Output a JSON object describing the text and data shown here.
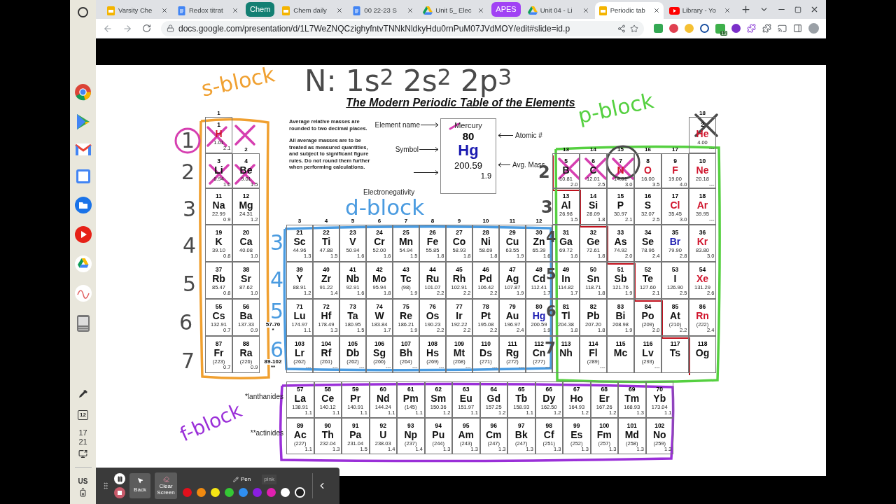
{
  "tabs": [
    {
      "kind": "tab",
      "title": "Varsity Che",
      "selected": false
    },
    {
      "kind": "tab",
      "title": "Redox titrat",
      "selected": false
    },
    {
      "kind": "group",
      "title": "Chem",
      "color": "#137f73"
    },
    {
      "kind": "tab",
      "title": "Chem daily",
      "selected": false
    },
    {
      "kind": "tab",
      "title": "00 22-23 S",
      "selected": false
    },
    {
      "kind": "tab",
      "title": "Unit 5_ Elec",
      "selected": false
    },
    {
      "kind": "group",
      "title": "APES",
      "color": "#a142f4"
    },
    {
      "kind": "tab",
      "title": "Unit 04 - Li",
      "selected": false
    },
    {
      "kind": "tab",
      "title": "Periodic tab",
      "selected": true
    },
    {
      "kind": "tab",
      "title": "Library - Yo",
      "selected": false
    }
  ],
  "address_bar": {
    "url": "docs.google.com/presentation/d/1L7WeZNQCzighyfntvTNNkNldkyHdu0rnPuM07JVdMOY/edit#slide=id.p",
    "extension_badge": "13"
  },
  "shelf": {
    "calendar_day": "12",
    "time_hour": "17",
    "time_minute": "21",
    "keyboard": "US"
  },
  "slide": {
    "title": "The Modern Periodic Table of the Elements",
    "notes": [
      "Average relative masses are  rounded to two decimal places.",
      "All average masses are to be treated as measured quantities, and subject to significant figure rules. Do not round them further when performing calculations."
    ],
    "key": {
      "name_label": "Element name",
      "name": "Mercury",
      "number": "80",
      "number_label": "Atomic #",
      "symbol_label": "Symbol",
      "symbol": "Hg",
      "mass": "200.59",
      "mass_label": "Avg. Mass",
      "en": "1.9",
      "en_label": "Electronegativity"
    },
    "group_labels": [
      "1",
      "18",
      "2",
      "13",
      "14",
      "15",
      "16",
      "17",
      "3",
      "4",
      "5",
      "6",
      "7",
      "8",
      "9",
      "10",
      "11",
      "12"
    ],
    "periods": [
      [
        {
          "kind": "element",
          "number": "1",
          "symbol": "H",
          "mass": "1.01",
          "en": "2.1",
          "color": "#d0142c"
        },
        {
          "kind": "element",
          "number": "2",
          "symbol": "He",
          "mass": "4.00",
          "en": "---",
          "color": "#d0142c"
        }
      ],
      [
        {
          "kind": "element",
          "number": "3",
          "symbol": "Li",
          "mass": "6.94",
          "en": "1.0"
        },
        {
          "kind": "element",
          "number": "4",
          "symbol": "Be",
          "mass": "9.01",
          "en": "1.5"
        },
        {
          "kind": "element",
          "number": "5",
          "symbol": "B",
          "mass": "10.81",
          "en": "2.0"
        },
        {
          "kind": "element",
          "number": "6",
          "symbol": "C",
          "mass": "12.01",
          "en": "2.5"
        },
        {
          "kind": "element",
          "number": "7",
          "symbol": "N",
          "mass": "14.01",
          "en": "3.0",
          "color": "#d0142c"
        },
        {
          "kind": "element",
          "number": "8",
          "symbol": "O",
          "mass": "16.00",
          "en": "3.5",
          "color": "#d0142c"
        },
        {
          "kind": "element",
          "number": "9",
          "symbol": "F",
          "mass": "19.00",
          "en": "4.0",
          "color": "#d0142c"
        },
        {
          "kind": "element",
          "number": "10",
          "symbol": "Ne",
          "mass": "20.18",
          "en": "---",
          "color": "#d0142c"
        }
      ],
      [
        {
          "kind": "element",
          "number": "11",
          "symbol": "Na",
          "mass": "22.99",
          "en": "0.9"
        },
        {
          "kind": "element",
          "number": "12",
          "symbol": "Mg",
          "mass": "24.31",
          "en": "1.2"
        },
        {
          "kind": "element",
          "number": "13",
          "symbol": "Al",
          "mass": "26.98",
          "en": "1.5"
        },
        {
          "kind": "element",
          "number": "14",
          "symbol": "Si",
          "mass": "28.09",
          "en": "1.8"
        },
        {
          "kind": "element",
          "number": "15",
          "symbol": "P",
          "mass": "30.97",
          "en": "2.1"
        },
        {
          "kind": "element",
          "number": "16",
          "symbol": "S",
          "mass": "32.07",
          "en": "2.5"
        },
        {
          "kind": "element",
          "number": "17",
          "symbol": "Cl",
          "mass": "35.45",
          "en": "3.0",
          "color": "#d0142c"
        },
        {
          "kind": "element",
          "number": "18",
          "symbol": "Ar",
          "mass": "39.95",
          "en": "---",
          "color": "#d0142c"
        }
      ],
      [
        {
          "kind": "element",
          "number": "19",
          "symbol": "K",
          "mass": "39.10",
          "en": "0.8"
        },
        {
          "kind": "element",
          "number": "20",
          "symbol": "Ca",
          "mass": "40.08",
          "en": "1.0"
        },
        {
          "kind": "element",
          "number": "21",
          "symbol": "Sc",
          "mass": "44.96",
          "en": "1.3"
        },
        {
          "kind": "element",
          "number": "22",
          "symbol": "Ti",
          "mass": "47.88",
          "en": "1.5"
        },
        {
          "kind": "element",
          "number": "23",
          "symbol": "V",
          "mass": "50.94",
          "en": "1.6"
        },
        {
          "kind": "element",
          "number": "24",
          "symbol": "Cr",
          "mass": "52.00",
          "en": "1.6"
        },
        {
          "kind": "element",
          "number": "25",
          "symbol": "Mn",
          "mass": "54.94",
          "en": "1.5"
        },
        {
          "kind": "element",
          "number": "26",
          "symbol": "Fe",
          "mass": "55.85",
          "en": "1.8"
        },
        {
          "kind": "element",
          "number": "27",
          "symbol": "Co",
          "mass": "58.93",
          "en": "1.8"
        },
        {
          "kind": "element",
          "number": "28",
          "symbol": "Ni",
          "mass": "58.69",
          "en": "1.8"
        },
        {
          "kind": "element",
          "number": "29",
          "symbol": "Cu",
          "mass": "63.55",
          "en": "1.9"
        },
        {
          "kind": "element",
          "number": "30",
          "symbol": "Zn",
          "mass": "65.39",
          "en": "1.6"
        },
        {
          "kind": "element",
          "number": "31",
          "symbol": "Ga",
          "mass": "69.72",
          "en": "1.6"
        },
        {
          "kind": "element",
          "number": "32",
          "symbol": "Ge",
          "mass": "72.61",
          "en": "1.8"
        },
        {
          "kind": "element",
          "number": "33",
          "symbol": "As",
          "mass": "74.92",
          "en": "2.0"
        },
        {
          "kind": "element",
          "number": "34",
          "symbol": "Se",
          "mass": "78.96",
          "en": "2.4"
        },
        {
          "kind": "element",
          "number": "35",
          "symbol": "Br",
          "mass": "79.90",
          "en": "2.8",
          "color": "#1b1bb0"
        },
        {
          "kind": "element",
          "number": "36",
          "symbol": "Kr",
          "mass": "83.80",
          "en": "3.0",
          "color": "#d0142c"
        }
      ],
      [
        {
          "kind": "element",
          "number": "37",
          "symbol": "Rb",
          "mass": "85.47",
          "en": "0.8"
        },
        {
          "kind": "element",
          "number": "38",
          "symbol": "Sr",
          "mass": "87.62",
          "en": "1.0"
        },
        {
          "kind": "element",
          "number": "39",
          "symbol": "Y",
          "mass": "88.91",
          "en": "1.2"
        },
        {
          "kind": "element",
          "number": "40",
          "symbol": "Zr",
          "mass": "91.22",
          "en": "1.4"
        },
        {
          "kind": "element",
          "number": "41",
          "symbol": "Nb",
          "mass": "92.91",
          "en": "1.6"
        },
        {
          "kind": "element",
          "number": "42",
          "symbol": "Mo",
          "mass": "95.94",
          "en": "1.8"
        },
        {
          "kind": "element",
          "number": "43",
          "symbol": "Tc",
          "mass": "(98)",
          "en": "1.9"
        },
        {
          "kind": "element",
          "number": "44",
          "symbol": "Ru",
          "mass": "101.07",
          "en": "2.2"
        },
        {
          "kind": "element",
          "number": "45",
          "symbol": "Rh",
          "mass": "102.91",
          "en": "2.2"
        },
        {
          "kind": "element",
          "number": "46",
          "symbol": "Pd",
          "mass": "106.42",
          "en": "2.2"
        },
        {
          "kind": "element",
          "number": "47",
          "symbol": "Ag",
          "mass": "107.87",
          "en": "1.9"
        },
        {
          "kind": "element",
          "number": "48",
          "symbol": "Cd",
          "mass": "112.41",
          "en": "1.7"
        },
        {
          "kind": "element",
          "number": "49",
          "symbol": "In",
          "mass": "114.82",
          "en": "1.7"
        },
        {
          "kind": "element",
          "number": "50",
          "symbol": "Sn",
          "mass": "118.71",
          "en": "1.8"
        },
        {
          "kind": "element",
          "number": "51",
          "symbol": "Sb",
          "mass": "121.76",
          "en": "1.9"
        },
        {
          "kind": "element",
          "number": "52",
          "symbol": "Te",
          "mass": "127.60",
          "en": "2.1"
        },
        {
          "kind": "element",
          "number": "53",
          "symbol": "I",
          "mass": "126.90",
          "en": "2.5"
        },
        {
          "kind": "element",
          "number": "54",
          "symbol": "Xe",
          "mass": "131.29",
          "en": "2.6",
          "color": "#d0142c"
        }
      ],
      [
        {
          "kind": "element",
          "number": "55",
          "symbol": "Cs",
          "mass": "132.91",
          "en": "0.7"
        },
        {
          "kind": "element",
          "number": "56",
          "symbol": "Ba",
          "mass": "137.33",
          "en": "0.9"
        },
        {
          "kind": "ref",
          "range": "57-70",
          "mark": "*"
        },
        {
          "kind": "element",
          "number": "71",
          "symbol": "Lu",
          "mass": "174.97",
          "en": "1.1"
        },
        {
          "kind": "element",
          "number": "72",
          "symbol": "Hf",
          "mass": "178.49",
          "en": "1.3"
        },
        {
          "kind": "element",
          "number": "73",
          "symbol": "Ta",
          "mass": "180.95",
          "en": "1.5"
        },
        {
          "kind": "element",
          "number": "74",
          "symbol": "W",
          "mass": "183.84",
          "en": "1.7"
        },
        {
          "kind": "element",
          "number": "75",
          "symbol": "Re",
          "mass": "186.21",
          "en": "1.9"
        },
        {
          "kind": "element",
          "number": "76",
          "symbol": "Os",
          "mass": "190.23",
          "en": "2.2"
        },
        {
          "kind": "element",
          "number": "77",
          "symbol": "Ir",
          "mass": "192.22",
          "en": "2.2"
        },
        {
          "kind": "element",
          "number": "78",
          "symbol": "Pt",
          "mass": "195.08",
          "en": "2.2"
        },
        {
          "kind": "element",
          "number": "79",
          "symbol": "Au",
          "mass": "196.97",
          "en": "2.4"
        },
        {
          "kind": "element",
          "number": "80",
          "symbol": "Hg",
          "mass": "200.59",
          "en": "1.9",
          "color": "#1b1bb0"
        },
        {
          "kind": "element",
          "number": "81",
          "symbol": "Tl",
          "mass": "204.38",
          "en": "1.8"
        },
        {
          "kind": "element",
          "number": "82",
          "symbol": "Pb",
          "mass": "207.20",
          "en": "1.8"
        },
        {
          "kind": "element",
          "number": "83",
          "symbol": "Bi",
          "mass": "208.98",
          "en": "1.9"
        },
        {
          "kind": "element",
          "number": "84",
          "symbol": "Po",
          "mass": "(209)",
          "en": "2.0"
        },
        {
          "kind": "element",
          "number": "85",
          "symbol": "At",
          "mass": "(210)",
          "en": "2.2"
        },
        {
          "kind": "element",
          "number": "86",
          "symbol": "Rn",
          "mass": "(222)",
          "en": "2.4",
          "color": "#d0142c"
        }
      ],
      [
        {
          "kind": "element",
          "number": "87",
          "symbol": "Fr",
          "mass": "(223)",
          "en": "0.7"
        },
        {
          "kind": "element",
          "number": "88",
          "symbol": "Ra",
          "mass": "(226)",
          "en": "0.9"
        },
        {
          "kind": "ref",
          "range": "89-102",
          "mark": "**"
        },
        {
          "kind": "element",
          "number": "103",
          "symbol": "Lr",
          "mass": "(262)",
          "en": "---"
        },
        {
          "kind": "element",
          "number": "104",
          "symbol": "Rf",
          "mass": "(261)",
          "en": "---"
        },
        {
          "kind": "element",
          "number": "105",
          "symbol": "Db",
          "mass": "(262)",
          "en": "---"
        },
        {
          "kind": "element",
          "number": "106",
          "symbol": "Sg",
          "mass": "(266)",
          "en": "---"
        },
        {
          "kind": "element",
          "number": "107",
          "symbol": "Bh",
          "mass": "(264)",
          "en": "---"
        },
        {
          "kind": "element",
          "number": "108",
          "symbol": "Hs",
          "mass": "(269)",
          "en": "---"
        },
        {
          "kind": "element",
          "number": "109",
          "symbol": "Mt",
          "mass": "(268)",
          "en": "---"
        },
        {
          "kind": "element",
          "number": "110",
          "symbol": "Ds",
          "mass": "(271)",
          "en": "---"
        },
        {
          "kind": "element",
          "number": "111",
          "symbol": "Rg",
          "mass": "(272)",
          "en": "---"
        },
        {
          "kind": "element",
          "number": "112",
          "symbol": "Cn",
          "mass": "(277)",
          "en": "---"
        },
        {
          "kind": "element",
          "number": "113",
          "symbol": "Nh"
        },
        {
          "kind": "element",
          "number": "114",
          "symbol": "Fl",
          "mass": "(289)",
          "en": "---"
        },
        {
          "kind": "element",
          "number": "115",
          "symbol": "Mc"
        },
        {
          "kind": "element",
          "number": "116",
          "symbol": "Lv",
          "mass": "(293)",
          "en": "---"
        },
        {
          "kind": "element",
          "number": "117",
          "symbol": "Ts"
        },
        {
          "kind": "element",
          "number": "118",
          "symbol": "Og"
        }
      ]
    ],
    "f_rows": [
      {
        "label": "*lanthanides",
        "elements": [
          {
            "number": "57",
            "symbol": "La",
            "mass": "138.91",
            "en": "1.1"
          },
          {
            "number": "58",
            "symbol": "Ce",
            "mass": "140.12",
            "en": "1.1"
          },
          {
            "number": "59",
            "symbol": "Pr",
            "mass": "140.91",
            "en": "1.1"
          },
          {
            "number": "60",
            "symbol": "Nd",
            "mass": "144.24",
            "en": "1.1"
          },
          {
            "number": "61",
            "symbol": "Pm",
            "mass": "(145)",
            "en": "1.1"
          },
          {
            "number": "62",
            "symbol": "Sm",
            "mass": "150.36",
            "en": "1.2"
          },
          {
            "number": "63",
            "symbol": "Eu",
            "mass": "151.97",
            "en": "1.1"
          },
          {
            "number": "64",
            "symbol": "Gd",
            "mass": "157.25",
            "en": "1.2"
          },
          {
            "number": "65",
            "symbol": "Tb",
            "mass": "158.93",
            "en": "1.1"
          },
          {
            "number": "66",
            "symbol": "Dy",
            "mass": "162.50",
            "en": "1.2"
          },
          {
            "number": "67",
            "symbol": "Ho",
            "mass": "164.93",
            "en": "1.2"
          },
          {
            "number": "68",
            "symbol": "Er",
            "mass": "167.26",
            "en": "1.2"
          },
          {
            "number": "69",
            "symbol": "Tm",
            "mass": "168.93",
            "en": "1.3"
          },
          {
            "number": "70",
            "symbol": "Yb",
            "mass": "173.04",
            "en": "1.1"
          }
        ]
      },
      {
        "label": "**actinides",
        "elements": [
          {
            "number": "89",
            "symbol": "Ac",
            "mass": "(227)",
            "en": "1.1"
          },
          {
            "number": "90",
            "symbol": "Th",
            "mass": "232.04",
            "en": "1.3"
          },
          {
            "number": "91",
            "symbol": "Pa",
            "mass": "231.04",
            "en": "1.5"
          },
          {
            "number": "92",
            "symbol": "U",
            "mass": "238.03",
            "en": "1.4"
          },
          {
            "number": "93",
            "symbol": "Np",
            "mass": "(237)",
            "en": "1.4"
          },
          {
            "number": "94",
            "symbol": "Pu",
            "mass": "(244)",
            "en": "1.3"
          },
          {
            "number": "95",
            "symbol": "Am",
            "mass": "(243)",
            "en": "1.3"
          },
          {
            "number": "96",
            "symbol": "Cm",
            "mass": "(247)",
            "en": "1.3"
          },
          {
            "number": "97",
            "symbol": "Bk",
            "mass": "(247)",
            "en": "1.3"
          },
          {
            "number": "98",
            "symbol": "Cf",
            "mass": "(251)",
            "en": "1.3"
          },
          {
            "number": "99",
            "symbol": "Es",
            "mass": "(252)",
            "en": "1.3"
          },
          {
            "number": "100",
            "symbol": "Fm",
            "mass": "(257)",
            "en": "1.3"
          },
          {
            "number": "101",
            "symbol": "Md",
            "mass": "(258)",
            "en": "1.3"
          },
          {
            "number": "102",
            "symbol": "No",
            "mass": "(259)",
            "en": "1.3"
          }
        ]
      }
    ],
    "annotations": [
      {
        "text": "s-block",
        "color": "#f0a030"
      },
      {
        "text": "N: 1s$^{2}$ 2s$^{2}$ 2p$^{3}$",
        "color": "#4a4a4a"
      },
      {
        "text": "p-block",
        "color": "#55d040"
      },
      {
        "text": "d-block",
        "color": "#4a9be0"
      },
      {
        "text": "f-block",
        "color": "#9a2fd8"
      },
      {
        "text": "1",
        "color": "#4a4a4a"
      },
      {
        "text": "2",
        "color": "#4a4a4a"
      },
      {
        "text": "3",
        "color": "#4a4a4a"
      },
      {
        "text": "4",
        "color": "#4a4a4a"
      },
      {
        "text": "5",
        "color": "#4a4a4a"
      },
      {
        "text": "6",
        "color": "#4a4a4a"
      },
      {
        "text": "7",
        "color": "#4a4a4a"
      },
      {
        "text": "3",
        "color": "#4a9be0"
      },
      {
        "text": "4",
        "color": "#4a9be0"
      },
      {
        "text": "5",
        "color": "#4a9be0"
      },
      {
        "text": "6",
        "color": "#4a9be0"
      },
      {
        "text": "2",
        "color": "#4a4a4a"
      },
      {
        "text": "3",
        "color": "#4a4a4a"
      },
      {
        "text": "4",
        "color": "#4a4a4a"
      },
      {
        "text": "5",
        "color": "#4a4a4a"
      },
      {
        "text": "6",
        "color": "#4a4a4a"
      },
      {
        "text": "7",
        "color": "#4a4a4a"
      }
    ]
  },
  "draw_toolbar": {
    "back": "Back",
    "clear": "Clear Screen",
    "pen": "Pen",
    "tooltip": "pink",
    "colors": [
      {
        "color": "#e3101c",
        "selected": false
      },
      {
        "color": "#f08a10",
        "selected": false
      },
      {
        "color": "#f5e614",
        "selected": false
      },
      {
        "color": "#35c835",
        "selected": false
      },
      {
        "color": "#2f8ff0",
        "selected": false
      },
      {
        "color": "#8a1ee0",
        "selected": false
      },
      {
        "color": "#e020b0",
        "selected": false
      },
      {
        "color": "#ffffff",
        "selected": false
      },
      {
        "color": "#202020",
        "selected": true
      }
    ]
  }
}
